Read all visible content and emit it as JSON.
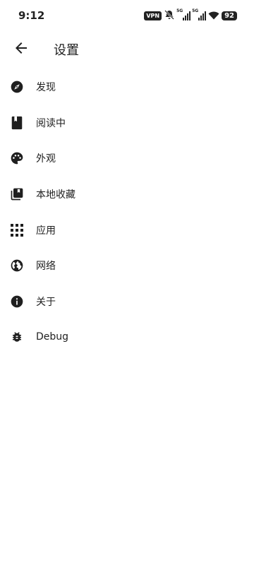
{
  "status_bar": {
    "time": "9:12",
    "vpn": "VPN",
    "network_1": "5G",
    "network_2": "5G",
    "battery": "92"
  },
  "header": {
    "title": "设置"
  },
  "menu": {
    "items": [
      {
        "label": "发现",
        "icon": "compass-icon"
      },
      {
        "label": "阅读中",
        "icon": "bookmark-book-icon"
      },
      {
        "label": "外观",
        "icon": "palette-icon"
      },
      {
        "label": "本地收藏",
        "icon": "collections-bookmark-icon"
      },
      {
        "label": "应用",
        "icon": "apps-grid-icon"
      },
      {
        "label": "网络",
        "icon": "globe-icon"
      },
      {
        "label": "关于",
        "icon": "info-icon"
      },
      {
        "label": "Debug",
        "icon": "bug-icon"
      }
    ]
  }
}
